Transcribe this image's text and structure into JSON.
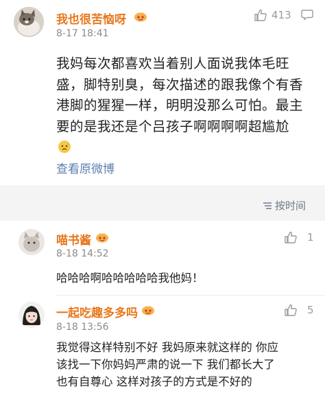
{
  "post": {
    "username": "我也很苦恼呀",
    "time": "8-17 18:41",
    "likes": "413",
    "content_text": "我妈每次都喜欢当着别人面说我体毛旺盛，脚特别臭，每次描述的跟我像个有香港脚的猩猩一样，明明没那么可怕。最主要的是我还是个吕孩子啊啊啊啊超尴尬",
    "view_original": "查看原微博"
  },
  "sort": {
    "label": "按时间"
  },
  "comments": [
    {
      "username": "喵书酱",
      "time": "8-18 14:52",
      "likes": "1",
      "text": "哈哈哈啊哈哈哈哈哈我他妈！"
    },
    {
      "username": "一起吃趣多多吗",
      "time": "8-18 13:56",
      "likes": "5",
      "text_lines": [
        "我觉得这样特别不好  我妈原来就这样的 你应",
        "该找一下你妈妈严肃的说一下 我们都长大了",
        "也有自尊心 这样对孩子的方式是不好的"
      ]
    }
  ],
  "colors": {
    "username": "#e8771b",
    "link": "#5b7fb0",
    "meta": "#8a8a8a"
  }
}
